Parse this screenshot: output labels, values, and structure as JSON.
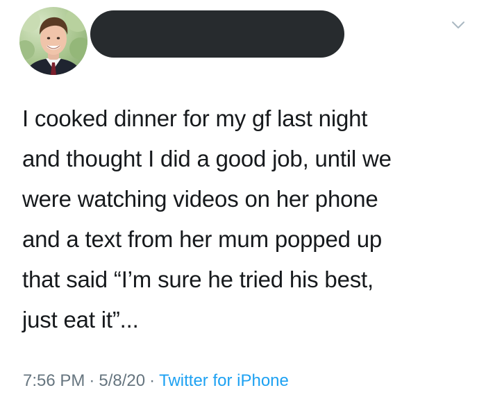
{
  "tweet": {
    "author": {
      "avatar_icon": "user-avatar-photo",
      "name_redacted": true,
      "redaction_color": "#272b2e"
    },
    "menu_icon": "chevron-down-icon",
    "lines": [
      "I cooked dinner for my gf last night",
      "and thought I did a good job, until we",
      "were watching videos on her phone",
      "and a text from her mum popped up",
      "that said “I’m sure he tried his best,",
      "just eat it”..."
    ],
    "meta": {
      "time": "7:56 PM",
      "separator": "·",
      "date": "5/8/20",
      "source": "Twitter for iPhone"
    },
    "colors": {
      "text": "#16191c",
      "meta": "#66757f",
      "link": "#1da1f2"
    }
  }
}
